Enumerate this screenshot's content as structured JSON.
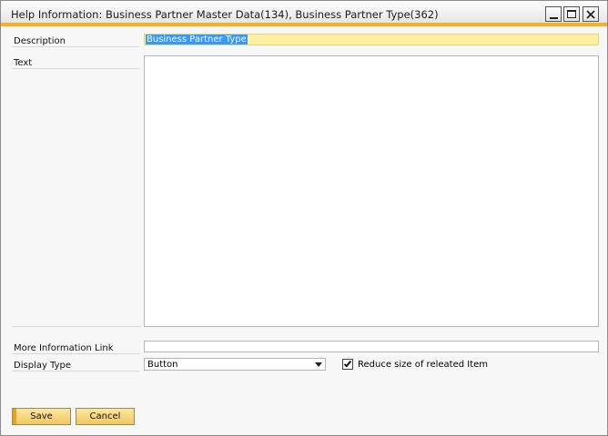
{
  "window": {
    "title": "Help Information: Business Partner Master Data(134), Business Partner Type(362)",
    "accent_color": "#f5b324"
  },
  "form": {
    "description_label": "Description",
    "description_value": "Business Partner Type",
    "text_label": "Text",
    "text_value": "",
    "more_info_label": "More Information Link",
    "more_info_value": "",
    "display_type_label": "Display Type",
    "display_type_value": "Button",
    "reduce_size_label": "Reduce size of releated Item",
    "reduce_size_checked": true
  },
  "buttons": {
    "save_label": "Save",
    "cancel_label": "Cancel"
  }
}
